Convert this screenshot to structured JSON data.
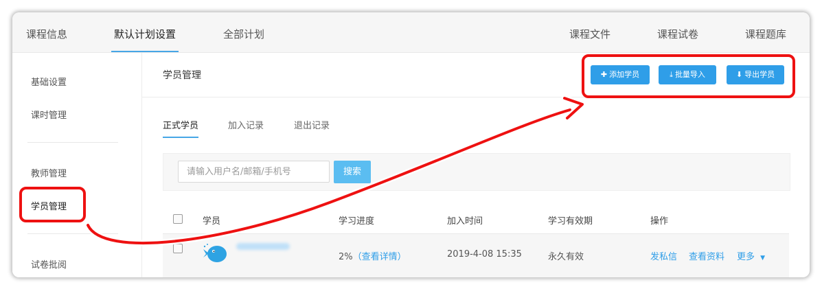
{
  "topnav": {
    "tabs": [
      {
        "label": "课程信息"
      },
      {
        "label": "默认计划设置"
      },
      {
        "label": "全部计划"
      }
    ],
    "right_tabs": [
      {
        "label": "课程文件"
      },
      {
        "label": "课程试卷"
      },
      {
        "label": "课程题库"
      }
    ],
    "active_tab": "默认计划设置"
  },
  "sidebar": {
    "items": [
      {
        "label": "基础设置"
      },
      {
        "label": "课时管理"
      },
      {
        "label": "教师管理"
      },
      {
        "label": "学员管理"
      },
      {
        "label": "试卷批阅"
      }
    ],
    "active_item": "学员管理"
  },
  "panel": {
    "title": "学员管理",
    "buttons": [
      {
        "label": "添加学员",
        "icon": "plus-icon"
      },
      {
        "label": "批量导入",
        "icon": "import-icon"
      },
      {
        "label": "导出学员",
        "icon": "download-icon"
      }
    ]
  },
  "subtabs": [
    {
      "label": "正式学员"
    },
    {
      "label": "加入记录"
    },
    {
      "label": "退出记录"
    }
  ],
  "active_subtab": "正式学员",
  "search": {
    "placeholder": "请输入用户名/邮箱/手机号",
    "button_label": "搜索"
  },
  "table": {
    "columns": [
      "学员",
      "学习进度",
      "加入时间",
      "学习有效期",
      "操作"
    ],
    "rows": [
      {
        "progress": "2%",
        "progress_link": "（查看详情）",
        "joined": "2019-4-08 15:35",
        "validity": "永久有效",
        "actions": [
          "发私信",
          "查看资料",
          "更多"
        ]
      }
    ]
  },
  "colors": {
    "accent": "#2f9ee8",
    "annotation_red": "#ee1111"
  }
}
